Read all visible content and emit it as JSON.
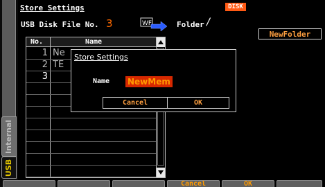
{
  "header": {
    "title": "Store Settings",
    "disk_badge": "DISK",
    "file_no_label": "USB Disk File No.",
    "file_no_value": "3",
    "wf_icon_text": "WF",
    "folder_label": "Folder",
    "folder_value": "/",
    "new_folder_label": "NewFolder"
  },
  "side_tabs": {
    "internal": "Internal",
    "usb": "USB"
  },
  "table": {
    "col_no": "No.",
    "col_name": "Name",
    "rows": [
      {
        "no": "1",
        "name": "Ne"
      },
      {
        "no": "2",
        "name": "TE"
      },
      {
        "no": "3",
        "name": ""
      },
      {
        "no": "",
        "name": ""
      },
      {
        "no": "",
        "name": ""
      },
      {
        "no": "",
        "name": ""
      },
      {
        "no": "",
        "name": ""
      },
      {
        "no": "",
        "name": ""
      },
      {
        "no": "",
        "name": ""
      },
      {
        "no": "",
        "name": ""
      },
      {
        "no": "",
        "name": ""
      }
    ],
    "selected_index": 2
  },
  "dialog": {
    "title": "Store Settings",
    "name_label": "Name",
    "name_value": "NewMem",
    "cancel_label": "Cancel",
    "ok_label": "OK"
  },
  "softkeys": [
    "",
    "",
    "",
    "Cancel",
    "OK",
    ""
  ],
  "colors": {
    "accent_orange": "#ff6a00",
    "button_text": "#ffa040",
    "disk_badge": "#ff5a14",
    "name_highlight": "#d62800",
    "usb_tab": "#e6c800"
  }
}
